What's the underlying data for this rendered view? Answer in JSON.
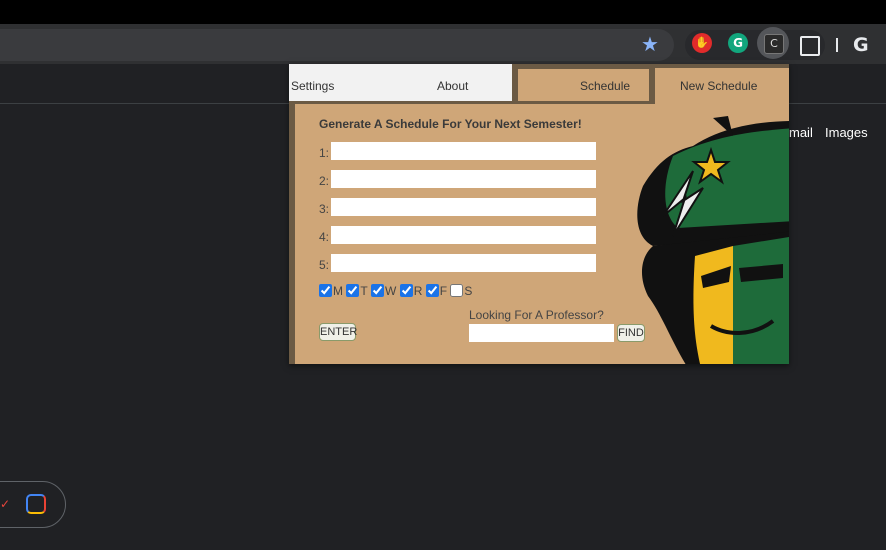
{
  "browser": {
    "extensions": {
      "c_label": "C",
      "grammarly_label": "G"
    },
    "profile_label": "G"
  },
  "page": {
    "gmail_label": "mail",
    "images_label": "Images"
  },
  "popup": {
    "tabs": [
      {
        "label": "Settings"
      },
      {
        "label": "About"
      },
      {
        "label": "Schedule"
      },
      {
        "label": "New Schedule"
      }
    ],
    "heading": "Generate A Schedule For Your Next Semester!",
    "course_rows": [
      {
        "label": "1:",
        "value": ""
      },
      {
        "label": "2:",
        "value": ""
      },
      {
        "label": "3:",
        "value": ""
      },
      {
        "label": "4:",
        "value": ""
      },
      {
        "label": "5:",
        "value": ""
      }
    ],
    "days": [
      {
        "label": "M",
        "checked": true
      },
      {
        "label": "T",
        "checked": true
      },
      {
        "label": "W",
        "checked": true
      },
      {
        "label": "R",
        "checked": true
      },
      {
        "label": "F",
        "checked": true
      },
      {
        "label": "S",
        "checked": false
      }
    ],
    "enter_label": "ENTER",
    "professor_label": "Looking For A Professor?",
    "professor_value": "",
    "find_label": "FIND"
  },
  "colors": {
    "popup_bg": "#cfa678",
    "popup_frame": "#6b5a44",
    "mascot_green": "#1e6b3a",
    "mascot_gold": "#f0b91e"
  }
}
